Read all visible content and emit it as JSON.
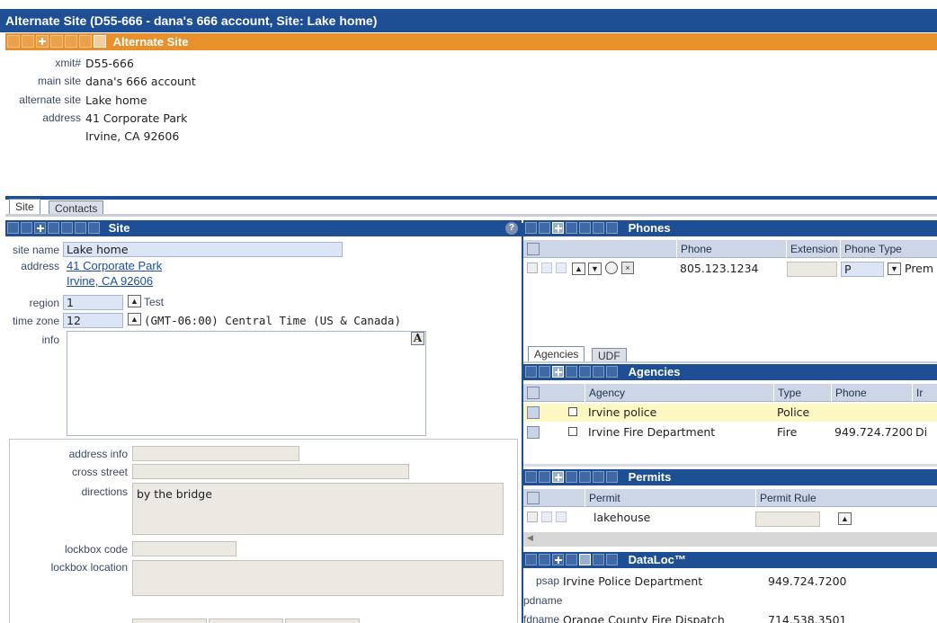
{
  "window": {
    "title": "Alternate Site (D55-666 - dana's 666 account, Site: Lake home)"
  },
  "section": {
    "title": "Alternate Site"
  },
  "header": {
    "xmit_label": "xmit#",
    "xmit_value": "D55-666",
    "main_site_label": "main site",
    "main_site_value": "dana's 666 account",
    "alt_site_label": "alternate site",
    "alt_site_value": "Lake home",
    "address_label": "address",
    "address_line1": "41 Corporate Park",
    "address_line2": "Irvine, CA 92606"
  },
  "tabs": {
    "site": "Site",
    "contacts": "Contacts"
  },
  "site_panel": {
    "title": "Site",
    "help": "?",
    "site_name_label": "site name",
    "site_name_value": "Lake home",
    "address_label": "address",
    "address_line1": "41 Corporate Park",
    "address_line2": "Irvine, CA 92606",
    "region_label": "region",
    "region_value": "1",
    "region_desc": "Test",
    "timezone_label": "time zone",
    "timezone_value": "12",
    "timezone_desc": "(GMT-06:00) Central Time (US & Canada)",
    "info_label": "info",
    "info_button": "A"
  },
  "lower_form": {
    "address_info_label": "address info",
    "cross_street_label": "cross street",
    "directions_label": "directions",
    "directions_value": "by the bridge",
    "lockbox_code_label": "lockbox code",
    "lockbox_location_label": "lockbox location"
  },
  "phones": {
    "title": "Phones",
    "columns": [
      "Phone",
      "Extension",
      "Phone Type"
    ],
    "rows": [
      {
        "phone": "805.123.1234",
        "extension": "",
        "type_code": "P",
        "type_desc": "Prem"
      }
    ]
  },
  "lower_tabs": {
    "agencies": "Agencies",
    "udf": "UDF"
  },
  "agencies": {
    "title": "Agencies",
    "columns": [
      "Agency",
      "Type",
      "Phone",
      "Ir"
    ],
    "rows": [
      {
        "agency": "Irvine police",
        "type": "Police",
        "phone": "",
        "extra": ""
      },
      {
        "agency": "Irvine Fire Department",
        "type": "Fire",
        "phone": "949.724.7200",
        "extra": "Di"
      }
    ]
  },
  "permits": {
    "title": "Permits",
    "columns": [
      "Permit",
      "Permit Rule"
    ],
    "rows": [
      {
        "permit": "lakehouse",
        "rule": ""
      }
    ]
  },
  "dataloc": {
    "title": "DataLoc™",
    "psap_label": "psap",
    "psap_name": "Irvine Police Department",
    "psap_phone": "949.724.7200",
    "pdname_label": "pdname",
    "fdname_label": "fdname",
    "fdname_name": "Orange County Fire Dispatch",
    "fdname_phone": "714.538.3501"
  },
  "colors": {
    "header_blue": "#1e4f95",
    "accent_orange": "#e8902a",
    "highlight_row": "#fdf7c3"
  }
}
